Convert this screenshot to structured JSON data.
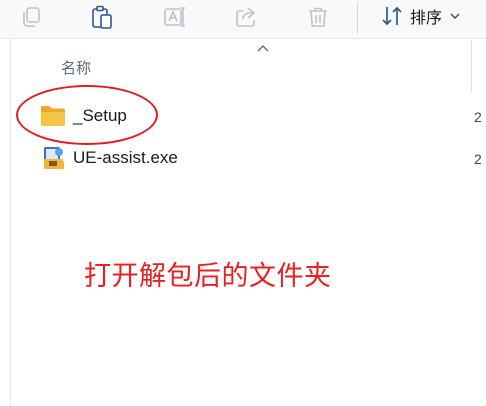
{
  "toolbar": {
    "buttons": [
      {
        "name": "copy-icon"
      },
      {
        "name": "paste-icon"
      },
      {
        "name": "rename-icon"
      },
      {
        "name": "share-icon"
      },
      {
        "name": "delete-icon"
      }
    ],
    "sort_label": "排序"
  },
  "columns": {
    "name_header": "名称"
  },
  "files": [
    {
      "name": "_Setup",
      "type": "folder",
      "date_fragment": "2"
    },
    {
      "name": "UE-assist.exe",
      "type": "exe",
      "date_fragment": "2"
    }
  ],
  "annotation": {
    "text": "打开解包后的文件夹",
    "color": "#e82020"
  },
  "colors": {
    "folder": "#f6c445",
    "icon_disabled": "#b9c4cf",
    "accent": "#2b579a"
  }
}
